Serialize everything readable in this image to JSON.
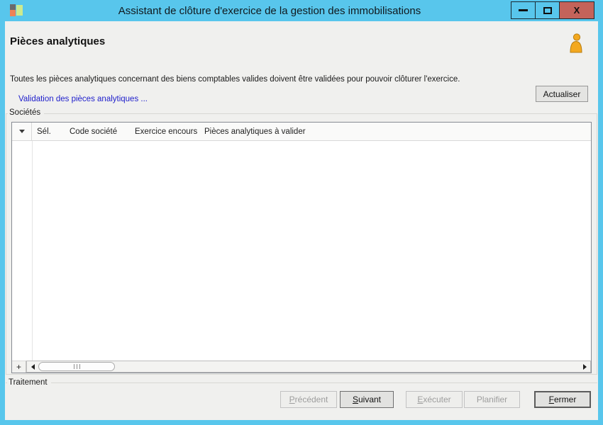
{
  "window": {
    "title": "Assistant de clôture d'exercice de la gestion des immobilisations",
    "controls": {
      "close_glyph": "X"
    }
  },
  "header": {
    "title": "Pièces analytiques"
  },
  "body": {
    "instruction": "Toutes les pièces analytiques concernant des biens comptables valides doivent être validées pour pouvoir clôturer l'exercice.",
    "link_label": "Validation des pièces analytiques ...",
    "refresh_button_label": "Actualiser"
  },
  "societes_group": {
    "label": "Sociétés",
    "table": {
      "columns": [
        {
          "name": "column-header-sel",
          "label": "Sél."
        },
        {
          "name": "column-header-code-societe",
          "label": "Code société"
        },
        {
          "name": "column-header-exercice-encours",
          "label": "Exercice encours"
        },
        {
          "name": "column-header-pieces-analytiques-a-valider",
          "label": "Pièces analytiques à valider"
        }
      ],
      "rows": []
    },
    "add_button_label": "+"
  },
  "traitement_group": {
    "label": "Traitement"
  },
  "footer": {
    "buttons": [
      {
        "name": "precedent-button",
        "label": "Précédent",
        "mnemonic": "P",
        "enabled": false,
        "default": false
      },
      {
        "name": "suivant-button",
        "label": "Suivant",
        "mnemonic": "S",
        "enabled": true,
        "default": false
      },
      {
        "name": "executer-button",
        "label": "Exécuter",
        "mnemonic": "E",
        "enabled": false,
        "default": false
      },
      {
        "name": "planifier-button",
        "label": "Planifier",
        "mnemonic": null,
        "enabled": false,
        "default": false
      },
      {
        "name": "fermer-button",
        "label": "Fermer",
        "mnemonic": "F",
        "enabled": true,
        "default": true
      }
    ]
  },
  "colors": {
    "titlebar_blue": "#58c6ec",
    "close_button_red": "#c4635a",
    "content_background": "#f0f0ee",
    "link_blue": "#2121cc",
    "user_icon_orange": "#f3a81f"
  }
}
